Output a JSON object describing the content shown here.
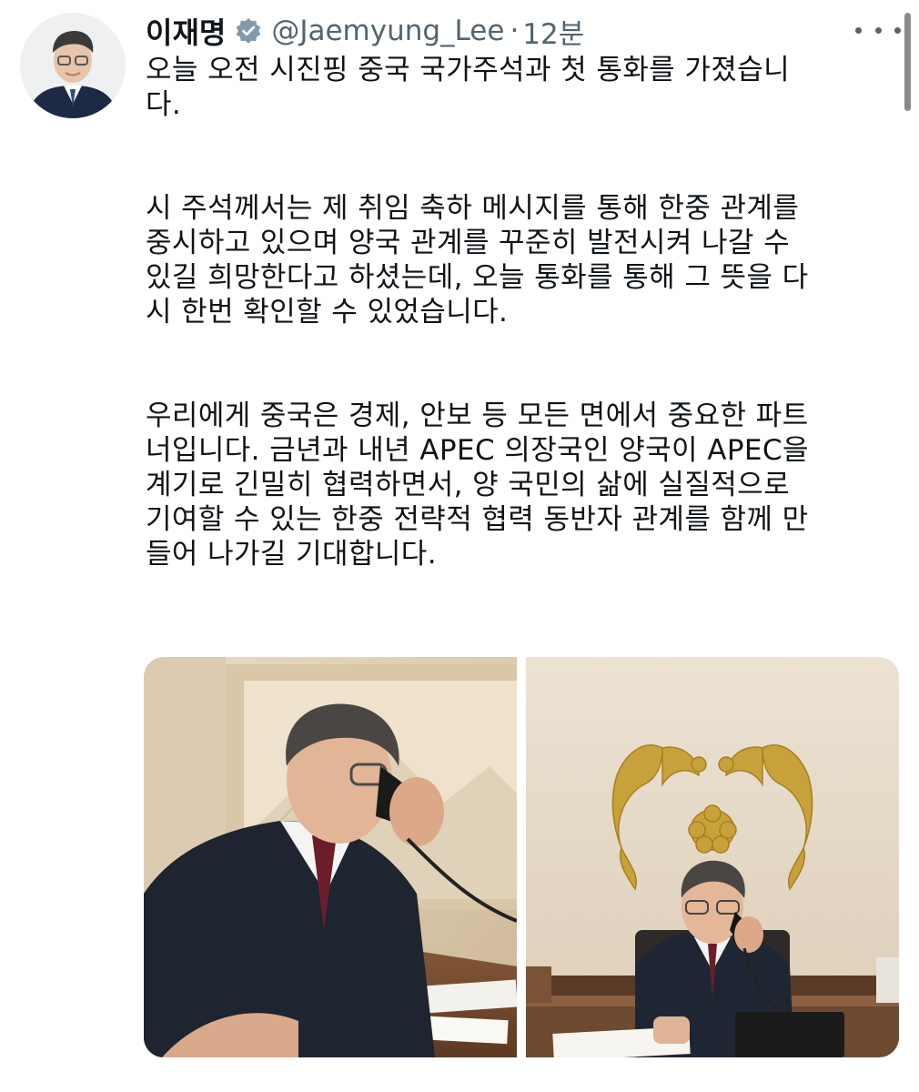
{
  "tweet": {
    "display_name": "이재명",
    "handle": "@Jaemyung_Lee",
    "separator": "·",
    "time_ago": "12분",
    "text_lines": [
      "오늘 오전 시진핑 중국 국가주석과 첫 통화를 가졌습니",
      "다.",
      "",
      "시 주석께서는 제 취임 축하 메시지를 통해 한중 관계를",
      "중시하고 있으며 양국 관계를 꾸준히 발전시켜 나갈 수",
      "있길 희망한다고 하셨는데, 오늘 통화를 통해 그 뜻을 다",
      "시 한번 확인할 수 있었습니다.",
      "",
      "우리에게 중국은 경제, 안보 등 모든 면에서 중요한 파트",
      "너입니다. 금년과 내년 APEC 의장국인 양국이 APEC을",
      "계기로 긴밀히 협력하면서, 양 국민의 삶에 실질적으로",
      "기여할 수 있는 한중 전략적 협력 동반자 관계를 함께 만",
      "들어 나가길 기대합니다."
    ],
    "icons": {
      "verified": "verified-badge-icon",
      "more": "more-options-icon"
    },
    "colors": {
      "text": "#0f1419",
      "secondary": "#536471"
    }
  }
}
